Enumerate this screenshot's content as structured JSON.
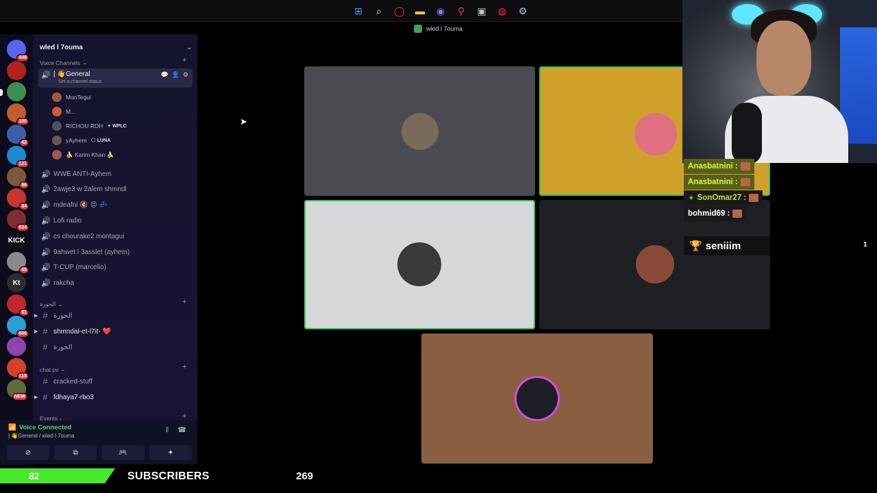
{
  "window": {
    "title": "wled l 7ouma"
  },
  "taskbar": {
    "icons": [
      "windows-icon",
      "search-icon",
      "opera-icon",
      "folder-icon",
      "discord-icon",
      "maps-icon",
      "obs-icon",
      "browser-icon",
      "steam-icon"
    ]
  },
  "servers": [
    {
      "label": "",
      "badge": "448",
      "color": "#5865f2"
    },
    {
      "label": "",
      "badge": "",
      "color": "#b3211e"
    },
    {
      "label": "",
      "badge": "",
      "color": "#3e8f4f"
    },
    {
      "label": "",
      "badge": "100",
      "color": "#c45b2d"
    },
    {
      "label": "",
      "badge": "42",
      "color": "#3a5fa8"
    },
    {
      "label": "",
      "badge": "121",
      "color": "#1f8ad1"
    },
    {
      "label": "",
      "badge": "86",
      "color": "#7b5a3a"
    },
    {
      "label": "",
      "badge": "84",
      "color": "#c9342d"
    },
    {
      "label": "",
      "badge": "634",
      "color": "#7d2f2f"
    },
    {
      "label": "KICK",
      "badge": "",
      "color": "#111"
    },
    {
      "label": "",
      "badge": "65",
      "color": "#8a8a8a"
    },
    {
      "label": "Kt",
      "badge": "",
      "color": "#2b2d31"
    },
    {
      "label": "",
      "badge": "91",
      "color": "#c0282c"
    },
    {
      "label": "",
      "badge": "606",
      "color": "#2a9fd6"
    },
    {
      "label": "",
      "badge": "",
      "color": "#8e44ad"
    },
    {
      "label": "",
      "badge": "118",
      "color": "#d6402a"
    },
    {
      "label": "",
      "badge": "NEW",
      "color": "#5e6c3a"
    }
  ],
  "sidebar": {
    "server_name": "wled l 7ouma",
    "voice_category": "Voice Channels",
    "general": {
      "name": "| 👋General",
      "status": "Set a channel status"
    },
    "voice_users": [
      {
        "name": "MonTegui",
        "tag": "",
        "color": "#a05a3a"
      },
      {
        "name": "M...",
        "tag": "",
        "color": "#d35a2e"
      },
      {
        "name": "RICHOU RDH",
        "tag": "✦ WPLC",
        "color": "#50535a"
      },
      {
        "name": "yAyhem",
        "tag": "🌕 LUNA",
        "color": "#6a5a4a"
      },
      {
        "name": "🍌 Karim Khan 🍌",
        "tag": "",
        "color": "#a05a4a"
      }
    ],
    "voice_channels": [
      "WWE ANTI-Ayhem",
      "2awje3 w 2alem shmndl",
      "mdeafni 🔇 😊 💤",
      "Lofi radio",
      "cs chourake2 montagui",
      "9ahwet l 3asslet (ayhem)",
      "T-CUP (marcello)",
      "rakcha"
    ],
    "cat_horra": "الحورة",
    "text_channels_a": [
      "الحورة",
      "shmndal-et-l7it- ❤️",
      "الحورة"
    ],
    "cat_chat": "chat pv",
    "text_channels_b": [
      "cracked-stuff",
      "fdhaya7-rbo3"
    ],
    "cat_events": "Events"
  },
  "voice_panel": {
    "title": "Voice Connected",
    "subtitle": "| 👋General / wled l 7ouma"
  },
  "subscribers": {
    "count": "82",
    "label": "SUBSCRIBERS",
    "goal": "269",
    "progress_fraction": 0.3
  },
  "video_tiles": [
    {
      "bg": "#4a4b50",
      "avatar": "#7a6a5a",
      "speaking": false
    },
    {
      "bg": "#cfa12a",
      "avatar": "#e07080",
      "speaking": true
    },
    {
      "bg": "#d6d7d8",
      "avatar": "#3a3a3a",
      "speaking": true
    },
    {
      "bg": "#1f2024",
      "avatar": "#8a4a3a",
      "speaking": false
    },
    {
      "bg": "#8a5f41",
      "avatar": "#1e1e26",
      "speaking": false
    }
  ],
  "chat": [
    {
      "user": "Anasbatnini :",
      "color": "#d3ff3a",
      "bg": "#5a5e1a"
    },
    {
      "user": "Anasbatnini :",
      "color": "#d3ff3a",
      "bg": "#5a5e1a"
    },
    {
      "user": "SonOmar27 :",
      "color": "#bfe24a",
      "bg": "#1a1a1c"
    },
    {
      "user": "bohmid69 :",
      "color": "#ffffff",
      "bg": "#1a1a1c"
    }
  ],
  "cheer": {
    "name": "seniiim",
    "count": "1"
  }
}
